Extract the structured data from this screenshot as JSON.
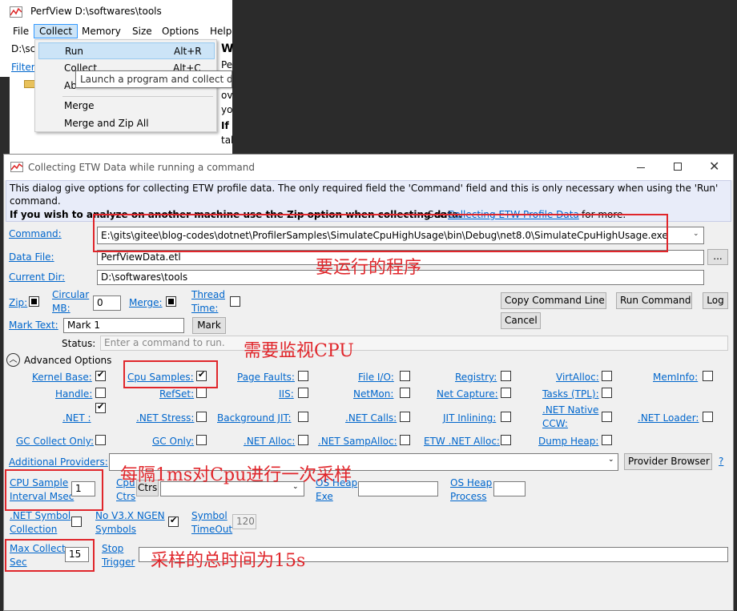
{
  "bg_window": {
    "title": "PerfView D:\\softwares\\tools",
    "menu": [
      "File",
      "Collect",
      "Memory",
      "Size",
      "Options",
      "Help"
    ],
    "path_frag": "D:\\sc",
    "filter_frag": "Filter",
    "right_frag": [
      "W",
      "Pe",
      "ov",
      "yo",
      "If",
      "tal"
    ]
  },
  "collect_menu": {
    "items": [
      {
        "label": "Run",
        "shortcut": "Alt+R"
      },
      {
        "label": "Collect",
        "shortcut": "Alt+C"
      },
      {
        "label": "Ab",
        "shortcut": ""
      },
      {
        "label": "Merge",
        "shortcut": ""
      },
      {
        "label": "Merge and Zip All",
        "shortcut": ""
      }
    ],
    "tooltip": "Launch a program and collect da"
  },
  "dialog": {
    "title": "Collecting ETW Data while running a command",
    "info_line1": "This dialog give options for collecting ETW profile data. The only required field the 'Command' field and this is only necessary when using the 'Run'",
    "info_line2": "command.",
    "info_bold": "If you wish to analyze on another machine use the Zip option when collecting data.",
    "info_see": "See",
    "info_link": "Collecting ETW Profile Data",
    "info_more": "for more.",
    "command_label": "Command:",
    "command_value": "E:\\gits\\gitee\\blog-codes\\dotnet\\ProfilerSamples\\SimulateCpuHighUsage\\bin\\Debug\\net8.0\\SimulateCpuHighUsage.exe",
    "datafile_label": "Data File:",
    "datafile_value": "PerfViewData.etl",
    "browse_label": "...",
    "curdir_label": "Current Dir:",
    "curdir_value": "D:\\softwares\\tools",
    "zip_label": "Zip:",
    "circular_label1": "Circular",
    "circular_label2": "MB:",
    "circular_value": "0",
    "merge_label": "Merge:",
    "thread_label1": "Thread",
    "thread_label2": "Time:",
    "copy_cmd": "Copy Command Line",
    "run_cmd": "Run Command",
    "log": "Log",
    "cancel": "Cancel",
    "marktext_label": "Mark Text:",
    "marktext_value": "Mark 1",
    "mark_btn": "Mark",
    "status_label": "Status:",
    "status_placeholder": "Enter a command to run.",
    "advanced": "Advanced Options",
    "row1": [
      "Kernel Base:",
      "Cpu Samples:",
      "Page Faults:",
      "File I/O:",
      "Registry:",
      "VirtAlloc:",
      "MemInfo:"
    ],
    "row2": [
      "Handle:",
      "RefSet:",
      "IIS:",
      "NetMon:",
      "Net Capture:",
      "Tasks (TPL):"
    ],
    "row3": [
      ".NET :",
      ".NET Stress:",
      "Background JIT:",
      ".NET Calls:",
      "JIT Inlining:",
      ".NET Native",
      "CCW:",
      ".NET Loader:"
    ],
    "row4": [
      "GC Collect Only:",
      "GC Only:",
      ".NET Alloc:",
      ".NET SampAlloc:",
      "ETW .NET Alloc:",
      "Dump Heap:"
    ],
    "providers_label": "Additional Providers:",
    "provider_browser": "Provider Browser",
    "help_q": "?",
    "cpu_interval1": "CPU Sample",
    "cpu_interval2": "Interval Msec",
    "cpu_interval_value": "1",
    "cpu_ctrs1": "Cpu",
    "cpu_ctrs2": "Ctrs",
    "ctrs_btn": "Ctrs",
    "osheap_exe1": "OS Heap",
    "osheap_exe2": "Exe",
    "osheap_proc1": "OS Heap",
    "osheap_proc2": "Process",
    "netsym1": ".NET Symbol",
    "netsym2": "Collection",
    "nov3_1": "No V3.X NGEN",
    "nov3_2": "Symbols",
    "symtimeout1": "Symbol",
    "symtimeout2": "TimeOut",
    "symtimeout_value": "120",
    "maxcollect1": "Max Collect",
    "maxcollect2": "Sec",
    "maxcollect_value": "15",
    "stoptrigger1": "Stop",
    "stoptrigger2": "Trigger"
  },
  "annotations": {
    "a1": "要运行的程序",
    "a2": "需要监视CPU",
    "a3": "每隔1ms对Cpu进行一次采样",
    "a4": "采样的总时间为15s"
  },
  "colors": {
    "link": "#0066cc",
    "annotation": "#e0262b",
    "info_bg": "#e8ecf9",
    "menu_highlight": "#cce4f7"
  }
}
